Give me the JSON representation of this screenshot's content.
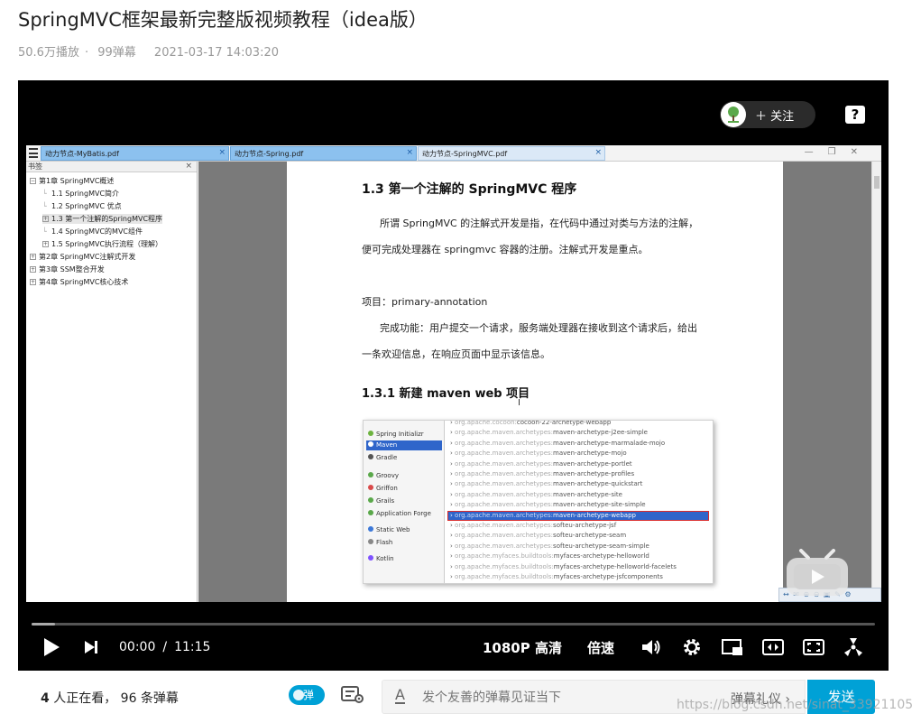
{
  "video": {
    "title": "SpringMVC框架最新完整版视频教程（idea版）",
    "plays": "50.6万播放",
    "danmaku_count": "99弹幕",
    "date": "2021-03-17 14:03:20"
  },
  "player": {
    "follow_label": "关注",
    "help_label": "?",
    "current_time": "00:00",
    "separator": "/",
    "duration": "11:15",
    "quality": "1080P 高清",
    "speed_label": "倍速",
    "progress": 0.028,
    "accent": "#00a1d6"
  },
  "pdf": {
    "tabs": [
      "动力节点-MyBatis.pdf",
      "动力节点-Spring.pdf",
      "动力节点-SpringMVC.pdf"
    ],
    "tab_close": "×",
    "bookmarks_title": "书签",
    "bookmarks": [
      {
        "label": "第1章 SpringMVC概述",
        "marker": "⊟"
      },
      {
        "label": "1.1 SpringMVC简介",
        "marker": ""
      },
      {
        "label": "1.2 SpringMVC 优点",
        "marker": ""
      },
      {
        "label": "1.3 第一个注解的SpringMVC程序",
        "marker": "⊞"
      },
      {
        "label": "1.4 SpringMVC的MVC组件",
        "marker": ""
      },
      {
        "label": "1.5 SpringMVC执行流程（理解）",
        "marker": "⊞"
      },
      {
        "label": "第2章 SpringMVC注解式开发",
        "marker": "⊞"
      },
      {
        "label": "第3章 SSM整合开发",
        "marker": "⊞"
      },
      {
        "label": "第4章 SpringMVC核心技术",
        "marker": "⊞"
      }
    ],
    "heading": "1.3 第一个注解的 SpringMVC 程序",
    "para1_line1": "所谓 SpringMVC 的注解式开发是指，在代码中通过对类与方法的注解，",
    "para1_line2": "便可完成处理器在 springmvc 容器的注册。注解式开发是重点。",
    "project": "项目：primary-annotation",
    "para2_line1": "完成功能：用户提交一个请求，服务端处理器在接收到这个请求后，给出",
    "para2_line2": "一条欢迎信息，在响应页面中显示该信息。",
    "subheading": "1.3.1 新建 maven web 项目",
    "cursor": "I",
    "generators": [
      "Spring Initializr",
      "Maven",
      "Gradle",
      "Groovy",
      "Griffon",
      "Grails",
      "Application Forge",
      "Static Web",
      "Flash",
      "Kotlin"
    ],
    "archetypes": [
      {
        "group": "org.apache.cocoon:",
        "artifact": "cocoon-22-archetype-webapp"
      },
      {
        "group": "org.apache.maven.archetypes:",
        "artifact": "maven-archetype-j2ee-simple"
      },
      {
        "group": "org.apache.maven.archetypes:",
        "artifact": "maven-archetype-marmalade-mojo"
      },
      {
        "group": "org.apache.maven.archetypes:",
        "artifact": "maven-archetype-mojo"
      },
      {
        "group": "org.apache.maven.archetypes:",
        "artifact": "maven-archetype-portlet"
      },
      {
        "group": "org.apache.maven.archetypes:",
        "artifact": "maven-archetype-profiles"
      },
      {
        "group": "org.apache.maven.archetypes:",
        "artifact": "maven-archetype-quickstart"
      },
      {
        "group": "org.apache.maven.archetypes:",
        "artifact": "maven-archetype-site"
      },
      {
        "group": "org.apache.maven.archetypes:",
        "artifact": "maven-archetype-site-simple"
      },
      {
        "group": "org.apache.maven.archetypes:",
        "artifact": "maven-archetype-webapp"
      },
      {
        "group": "org.apache.maven.archetypes:",
        "artifact": "softeu-archetype-jsf"
      },
      {
        "group": "org.apache.maven.archetypes:",
        "artifact": "softeu-archetype-seam"
      },
      {
        "group": "org.apache.maven.archetypes:",
        "artifact": "softeu-archetype-seam-simple"
      },
      {
        "group": "org.apache.myfaces.buildtools:",
        "artifact": "myfaces-archetype-helloworld"
      },
      {
        "group": "org.apache.myfaces.buildtools:",
        "artifact": "myfaces-archetype-helloworld-facelets"
      },
      {
        "group": "org.apache.myfaces.buildtools:",
        "artifact": "myfaces-archetype-jsfcomponents"
      }
    ]
  },
  "danmaku_bar": {
    "viewers_count": "4",
    "viewers_text": "人正在看，",
    "danmaku_num": "96",
    "danmaku_text": "条弹幕",
    "toggle_label": "弹",
    "input_icon": "A",
    "placeholder": "发个友善的弹幕见证当下",
    "etiquette": "弹幕礼仪 ›",
    "send": "发送"
  },
  "watermark": "https://blog.csdn.net/sinat_33921105"
}
